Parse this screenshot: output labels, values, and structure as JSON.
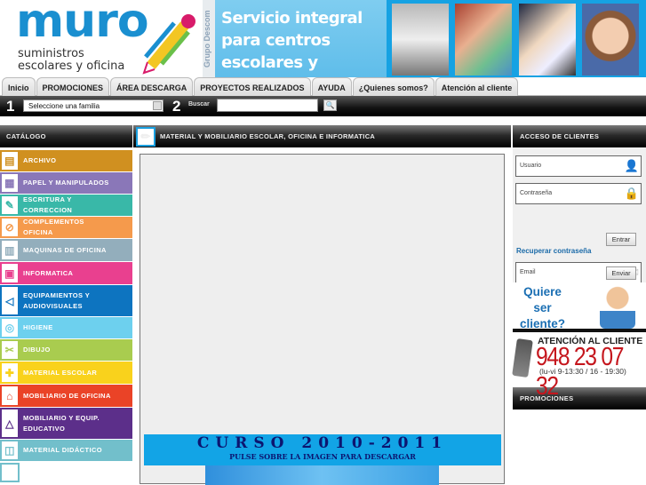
{
  "header": {
    "logo_text": "muro",
    "logo_sub1": "suministros",
    "logo_sub2": "escolares y oficina",
    "group_label": "Grupo Descom",
    "banner_text": "Servicio integral para centros escolares y oficinas"
  },
  "nav": {
    "tabs": [
      "Inicio",
      "PROMOCIONES",
      "ÁREA DESCARGA",
      "PROYECTOS REALIZADOS",
      "AYUDA",
      "¿Quienes somos?",
      "Atención al cliente"
    ]
  },
  "toolbar": {
    "step1": "1",
    "family_select": "Seleccione una familia",
    "step2": "2",
    "search_label": "Buscar",
    "search_value": ""
  },
  "catalog": {
    "title": "CATÁLOGO",
    "items": [
      {
        "label": "ARCHIVO",
        "color": "#d09020"
      },
      {
        "label": "PAPEL Y MANIPULADOS",
        "color": "#8a77b8"
      },
      {
        "label": "ESCRITURA Y CORRECCION",
        "color": "#39b8a8"
      },
      {
        "label": "COMPLEMENTOS OFICINA",
        "color": "#f59a4c"
      },
      {
        "label": "MAQUINAS DE OFICINA",
        "color": "#93aebc"
      },
      {
        "label": "INFORMATICA",
        "color": "#e9408f"
      },
      {
        "label": "EQUIPAMIENTOS Y AUDIOVISUALES",
        "color": "#0d74c0"
      },
      {
        "label": "HIGIENE",
        "color": "#6dd0ee"
      },
      {
        "label": "DIBUJO",
        "color": "#a9cc4f"
      },
      {
        "label": "MATERIAL ESCOLAR",
        "color": "#f9d21c"
      },
      {
        "label": "MOBILIARIO DE OFICINA",
        "color": "#ea4327"
      },
      {
        "label": "MOBILIARIO Y EQUIP. EDUCATIVO",
        "color": "#5c2f8a"
      },
      {
        "label": "MATERIAL DIDÁCTICO",
        "color": "#72bfcb"
      }
    ]
  },
  "main": {
    "title": "MATERIAL Y MOBILIARIO ESCOLAR, OFICINA E INFORMATICA",
    "course_title": "CURSO 2010-2011",
    "course_sub": "PULSE SOBRE LA IMAGEN PARA DESCARGAR"
  },
  "clients": {
    "title": "ACCESO DE CLIENTES",
    "user_placeholder": "Usuario",
    "password_placeholder": "Contraseña",
    "login_button": "Entrar",
    "recover_link": "Recuperar contraseña",
    "email_placeholder": "Email",
    "send_button": "Enviar",
    "promo_text": "Quiere ser cliente?"
  },
  "support": {
    "title": "ATENCIÓN AL CLIENTE",
    "phone": "948 23 07 32",
    "hours": "(lu-vi 9-13:30 / 16 - 19:30)"
  },
  "promotions": {
    "title": "PROMOCIONES"
  }
}
